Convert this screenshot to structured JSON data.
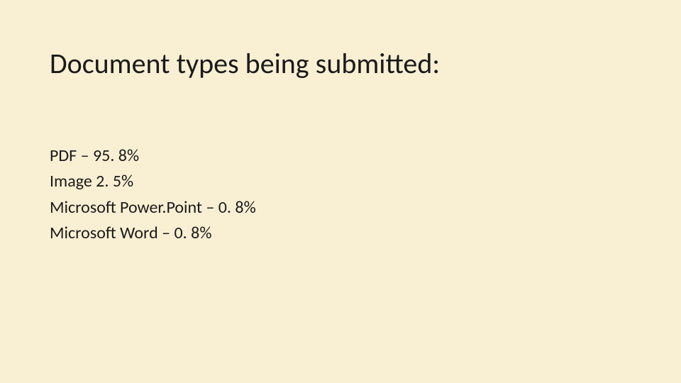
{
  "title": "Document types being submitted:",
  "items": [
    "PDF – 95. 8%",
    "Image 2. 5%",
    "Microsoft Power.Point – 0. 8%",
    "Microsoft Word – 0. 8%"
  ]
}
